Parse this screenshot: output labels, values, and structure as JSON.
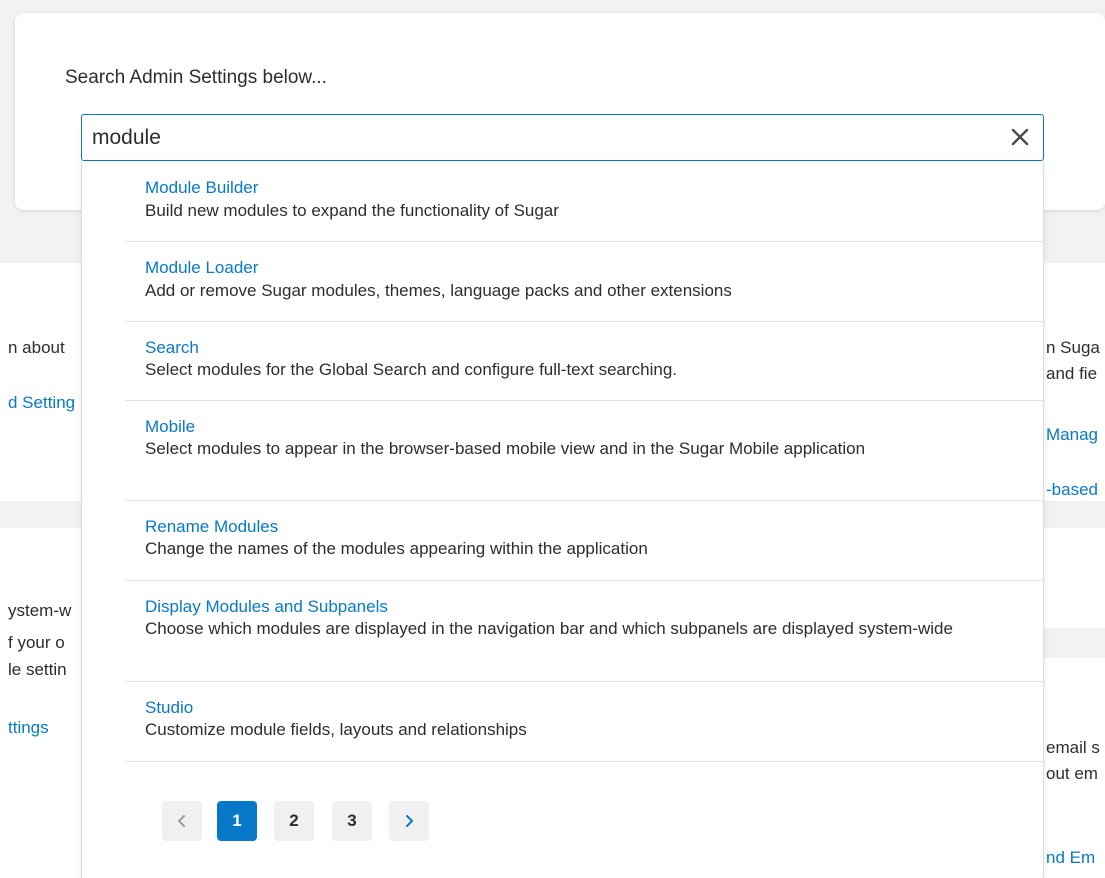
{
  "background": {
    "left_fragments": [
      "n about",
      "d Setting",
      "ystem-w",
      "f your o",
      "le settin",
      "ttings"
    ],
    "right_fragments": [
      "n Suga",
      "and fie",
      "Manag",
      "-based",
      "email s",
      "out em",
      "nd Em"
    ]
  },
  "search": {
    "heading": "Search Admin Settings below...",
    "value": "module",
    "placeholder": ""
  },
  "results": [
    {
      "title": "Module Builder",
      "description": "Build new modules to expand the functionality of Sugar"
    },
    {
      "title": "Module Loader",
      "description": "Add or remove Sugar modules, themes, language packs and other extensions"
    },
    {
      "title": "Search",
      "description": "Select modules for the Global Search and configure full-text searching."
    },
    {
      "title": "Mobile",
      "description": "Select modules to appear in the browser-based mobile view and in the Sugar Mobile application"
    },
    {
      "title": "Rename Modules",
      "description": "Change the names of the modules appearing within the application"
    },
    {
      "title": "Display Modules and Subpanels",
      "description": "Choose which modules are displayed in the navigation bar and which subpanels are displayed system-wide"
    },
    {
      "title": "Studio",
      "description": "Customize module fields, layouts and relationships"
    }
  ],
  "pagination": {
    "pages": [
      "1",
      "2",
      "3"
    ],
    "current": "1"
  },
  "colors": {
    "accent": "#0679c8",
    "text": "#2b2d2e",
    "background": "#f2f2f3"
  }
}
